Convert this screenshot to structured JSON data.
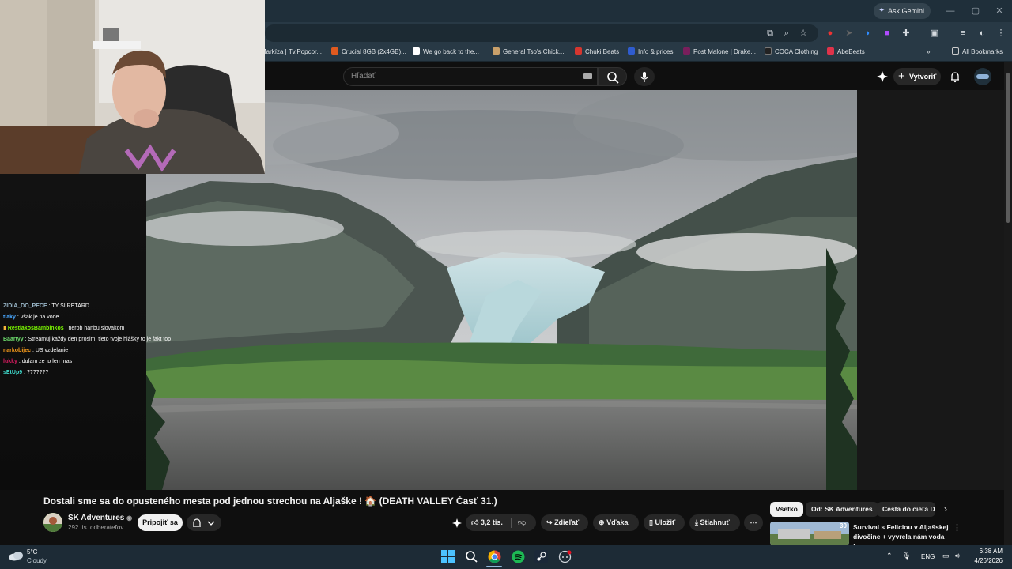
{
  "browser": {
    "ask_gemini": "Ask Gemini",
    "bookmarks": [
      {
        "label": "Markíza | Tv.Popcor...",
        "color": "#9a9a9a"
      },
      {
        "label": "Crucial 8GB (2x4GB)...",
        "color": "#e05a1f"
      },
      {
        "label": "We go back to the...",
        "color": "#ffffff"
      },
      {
        "label": "General Tso's Chick...",
        "color": "#c9a06a"
      },
      {
        "label": "Chuki Beats",
        "color": "#d6362f"
      },
      {
        "label": "Info & prices",
        "color": "#2f5ccf"
      },
      {
        "label": "Post Malone | Drake...",
        "color": "#7a1f5c"
      },
      {
        "label": "COCA Clothing",
        "color": "#222222"
      },
      {
        "label": "AbeBeats",
        "color": "#e0334a"
      }
    ],
    "all_bookmarks": "All Bookmarks",
    "more_bookmarks": "»"
  },
  "youtube": {
    "search_placeholder": "Hľadať",
    "create_label": "Vytvoriť",
    "video_title": "Dostali sme sa do opusteného mesta pod jednou strechou na Aljaške ! 🏠 (DEATH VALLEY Časť 31.)",
    "channel_name": "SK Adventures",
    "subscriber_count": "292 tis. odberateľov",
    "join_label": "Pripojiť sa",
    "like_count": "3,2 tis.",
    "share_label": "Zdieľať",
    "thanks_label": "Vďaka",
    "save_label": "Uložiť",
    "download_label": "Stiahnuť",
    "chips": [
      "Všetko",
      "Od: SK Adventures",
      "Cesta do cieľa Dea"
    ],
    "recommendation": {
      "title": "Survival s Feliciou v Aljašskej divočine + vyvrela nám voda !...",
      "badge": "30"
    }
  },
  "chat": [
    {
      "name": "ZIDIA_DO_PECE",
      "color": "#9ab7c9",
      "message": "TY SI RETARD"
    },
    {
      "name": "tlaky",
      "color": "#4aa8ff",
      "message": "však je na vode"
    },
    {
      "name": "RestiakosBambinkos",
      "color": "#7cfc00",
      "message": "nerob hanbu slovakom",
      "badge": true
    },
    {
      "name": "Baartyy",
      "color": "#6fe06f",
      "message": "Streamuj každy den prosim, tieto tvoje hlášky to je fakt top"
    },
    {
      "name": "narkobijec",
      "color": "#ff9f1a",
      "message": "US vzdelanie"
    },
    {
      "name": "lukky",
      "color": "#d81b60",
      "message": "dufam ze to len hras"
    },
    {
      "name": "sEtUp9",
      "color": "#3ed6c8",
      "message": "???????"
    }
  ],
  "taskbar": {
    "temperature": "5°C",
    "weather": "Cloudy",
    "language": "ENG",
    "time": "6:38 AM",
    "date": "4/26/2026"
  },
  "colors": {
    "chrome_frame": "#1f2f3a",
    "toolbar": "#283945",
    "yt_background": "#0f0f0f",
    "taskbar": "#1d2b36"
  }
}
